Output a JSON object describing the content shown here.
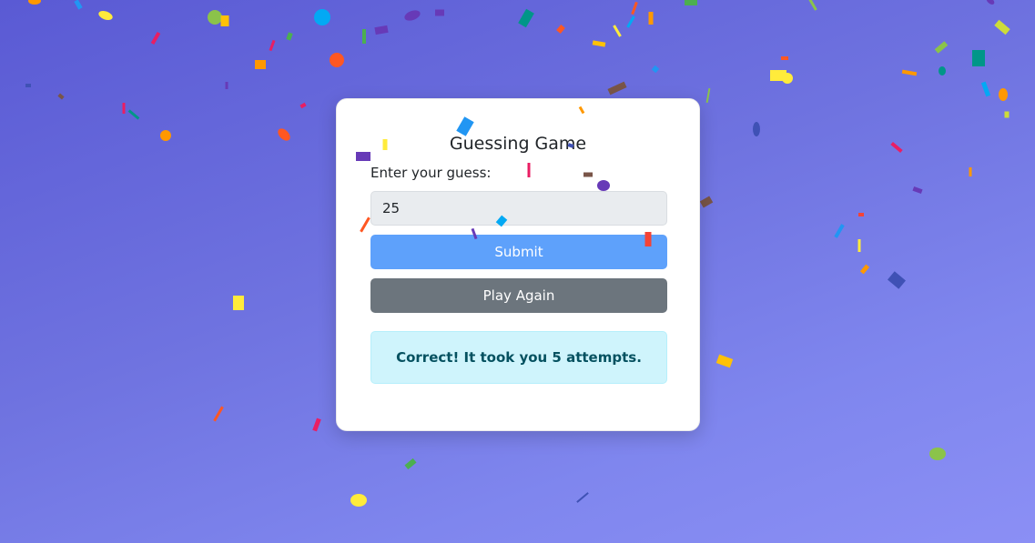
{
  "game": {
    "title": "Guessing Game",
    "input_label": "Enter your guess:",
    "guess_value": "25",
    "submit_label": "Submit",
    "play_again_label": "Play Again",
    "result_message": "Correct! It took you 5 attempts."
  },
  "theme": {
    "submit_color": "#5ea1fb",
    "play_again_color": "#6c757d",
    "alert_background": "#cff4fc",
    "alert_text_color": "#055160"
  },
  "confetti_colors": [
    "#ffeb3b",
    "#ff5722",
    "#4caf50",
    "#03a9f4",
    "#e91e63",
    "#673ab7",
    "#ff9800",
    "#8bc34a",
    "#795548",
    "#2196f3",
    "#009688",
    "#cddc39",
    "#3f51b5",
    "#ffc107",
    "#f44336"
  ]
}
